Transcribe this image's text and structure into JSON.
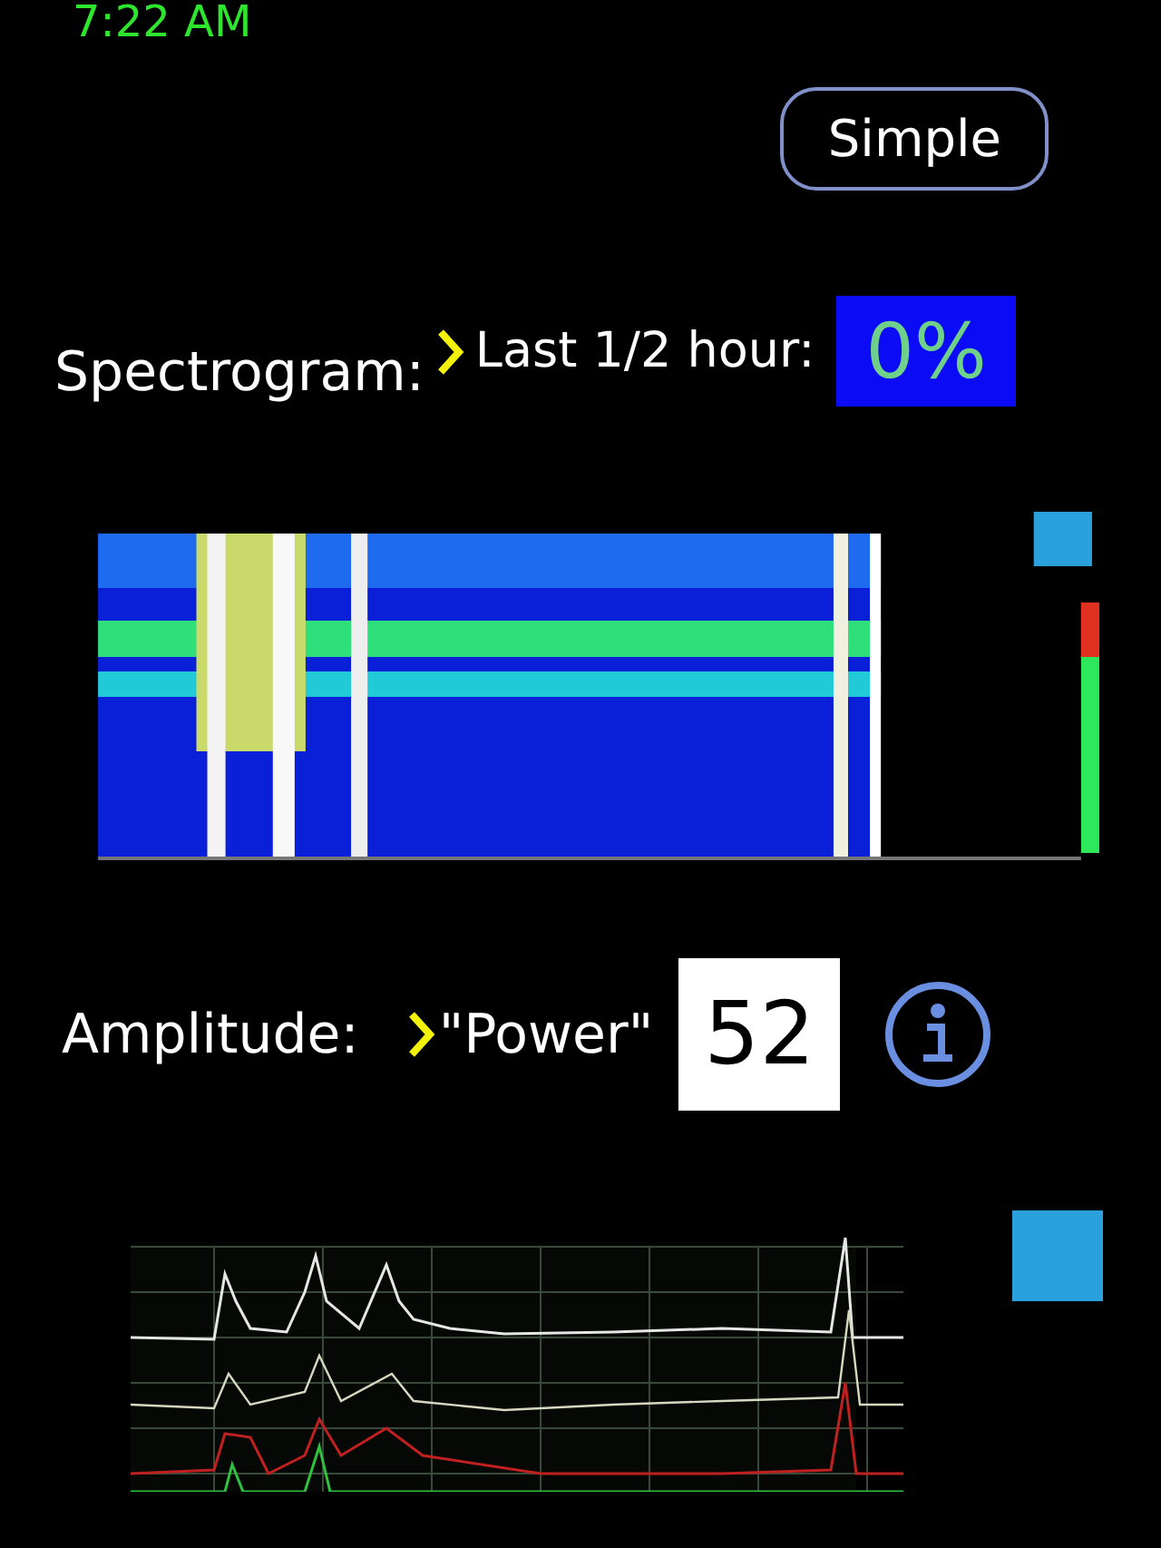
{
  "status_bar": {
    "time": "7:22 AM"
  },
  "mode_button": {
    "label": "Simple"
  },
  "spectrogram": {
    "label": "Spectrogram:",
    "period_label": "Last 1/2 hour:",
    "percentage": "0%"
  },
  "amplitude": {
    "label": "Amplitude:",
    "measure": "\"Power\"",
    "value": "52"
  }
}
